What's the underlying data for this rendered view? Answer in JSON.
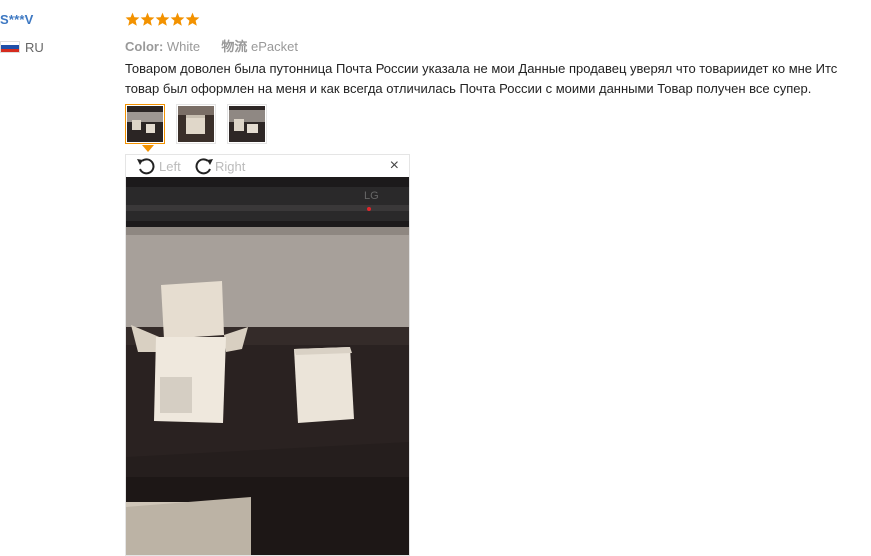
{
  "review": {
    "user_name": "S***V",
    "country_code": "RU",
    "rating_stars": 5,
    "color_label": "Color:",
    "color_value": "White",
    "shipping_label": "物流",
    "shipping_value": "ePacket",
    "text_line1": "Товаром доволен была путонница Почта России указала не мои Данные продавец уверял что товариидет ко мне Итс",
    "text_line2": "товар был оформлен на меня и как всегда отличилась Почта России с моими данными Товар получен все супер."
  },
  "viewer": {
    "rotate_left_label": "Left",
    "rotate_right_label": "Right",
    "close_label": "×",
    "tv_brand": "LG"
  },
  "colors": {
    "link_blue": "#3d78c2",
    "star_orange": "#f39200",
    "active_border": "#f39200",
    "flag_white": "#ffffff",
    "flag_blue": "#1f4fa8",
    "flag_red": "#d52b1e"
  },
  "icons": {
    "star": "star-icon",
    "flag": "russia-flag-icon",
    "rotate_left": "rotate-left-icon",
    "rotate_right": "rotate-right-icon",
    "close": "close-icon"
  }
}
